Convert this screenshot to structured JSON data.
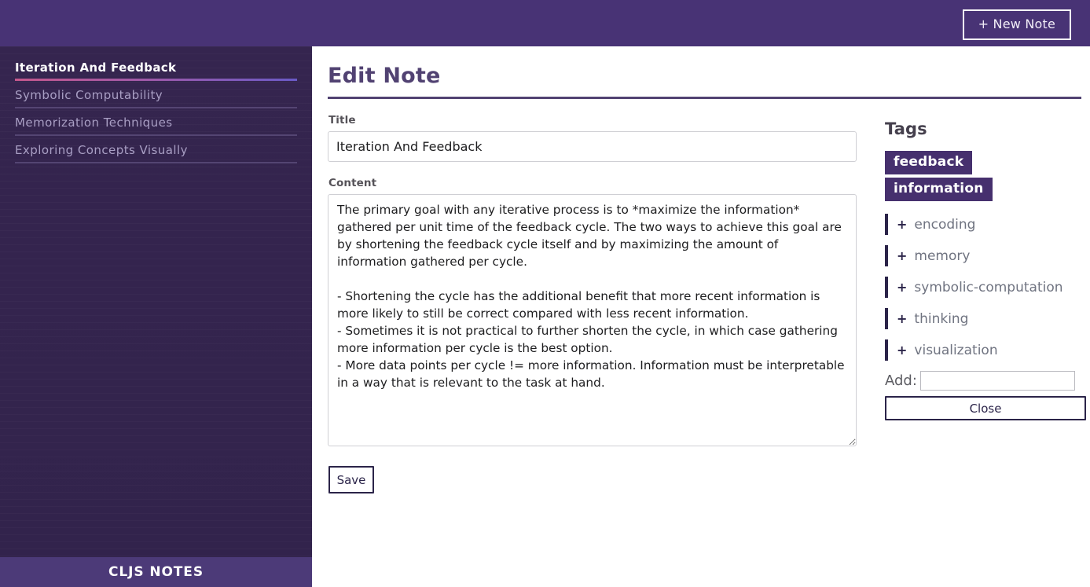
{
  "header": {
    "new_note_label": "+ New Note",
    "background_color": "#483375"
  },
  "sidebar": {
    "background_color": "#35254f",
    "active_underline_from": "#c4588c",
    "active_underline_to": "#6a5ac6",
    "items": [
      {
        "label": "Iteration And Feedback",
        "active": true
      },
      {
        "label": "Symbolic Computability",
        "active": false
      },
      {
        "label": "Memorization Techniques",
        "active": false
      },
      {
        "label": "Exploring Concepts Visually",
        "active": false
      }
    ],
    "footer_brand": "CLJS NOTES"
  },
  "main": {
    "page_title": "Edit Note",
    "title_label": "Title",
    "title_value": "Iteration And Feedback",
    "title_placeholder": "",
    "content_label": "Content",
    "content_value": "The primary goal with any iterative process is to *maximize the information* gathered per unit time of the feedback cycle. The two ways to achieve this goal are by shortening the feedback cycle itself and by maximizing the amount of information gathered per cycle.\n\n- Shortening the cycle has the additional benefit that more recent information is more likely to still be correct compared with less recent information.\n- Sometimes it is not practical to further shorten the cycle, in which case gathering more information per cycle is the best option.\n- More data points per cycle != more information. Information must be interpretable in a way that is relevant to the task at hand.",
    "content_placeholder": "",
    "save_label": "Save"
  },
  "tags": {
    "heading": "Tags",
    "assigned": [
      {
        "label": "feedback"
      },
      {
        "label": "information"
      }
    ],
    "available": [
      {
        "plus": "+",
        "label": "encoding"
      },
      {
        "plus": "+",
        "label": "memory"
      },
      {
        "plus": "+",
        "label": "symbolic-computation"
      },
      {
        "plus": "+",
        "label": "thinking"
      },
      {
        "plus": "+",
        "label": "visualization"
      }
    ],
    "add_label": "Add:",
    "add_value": "",
    "add_placeholder": "",
    "close_label": "Close",
    "chip_color": "#46306e"
  }
}
